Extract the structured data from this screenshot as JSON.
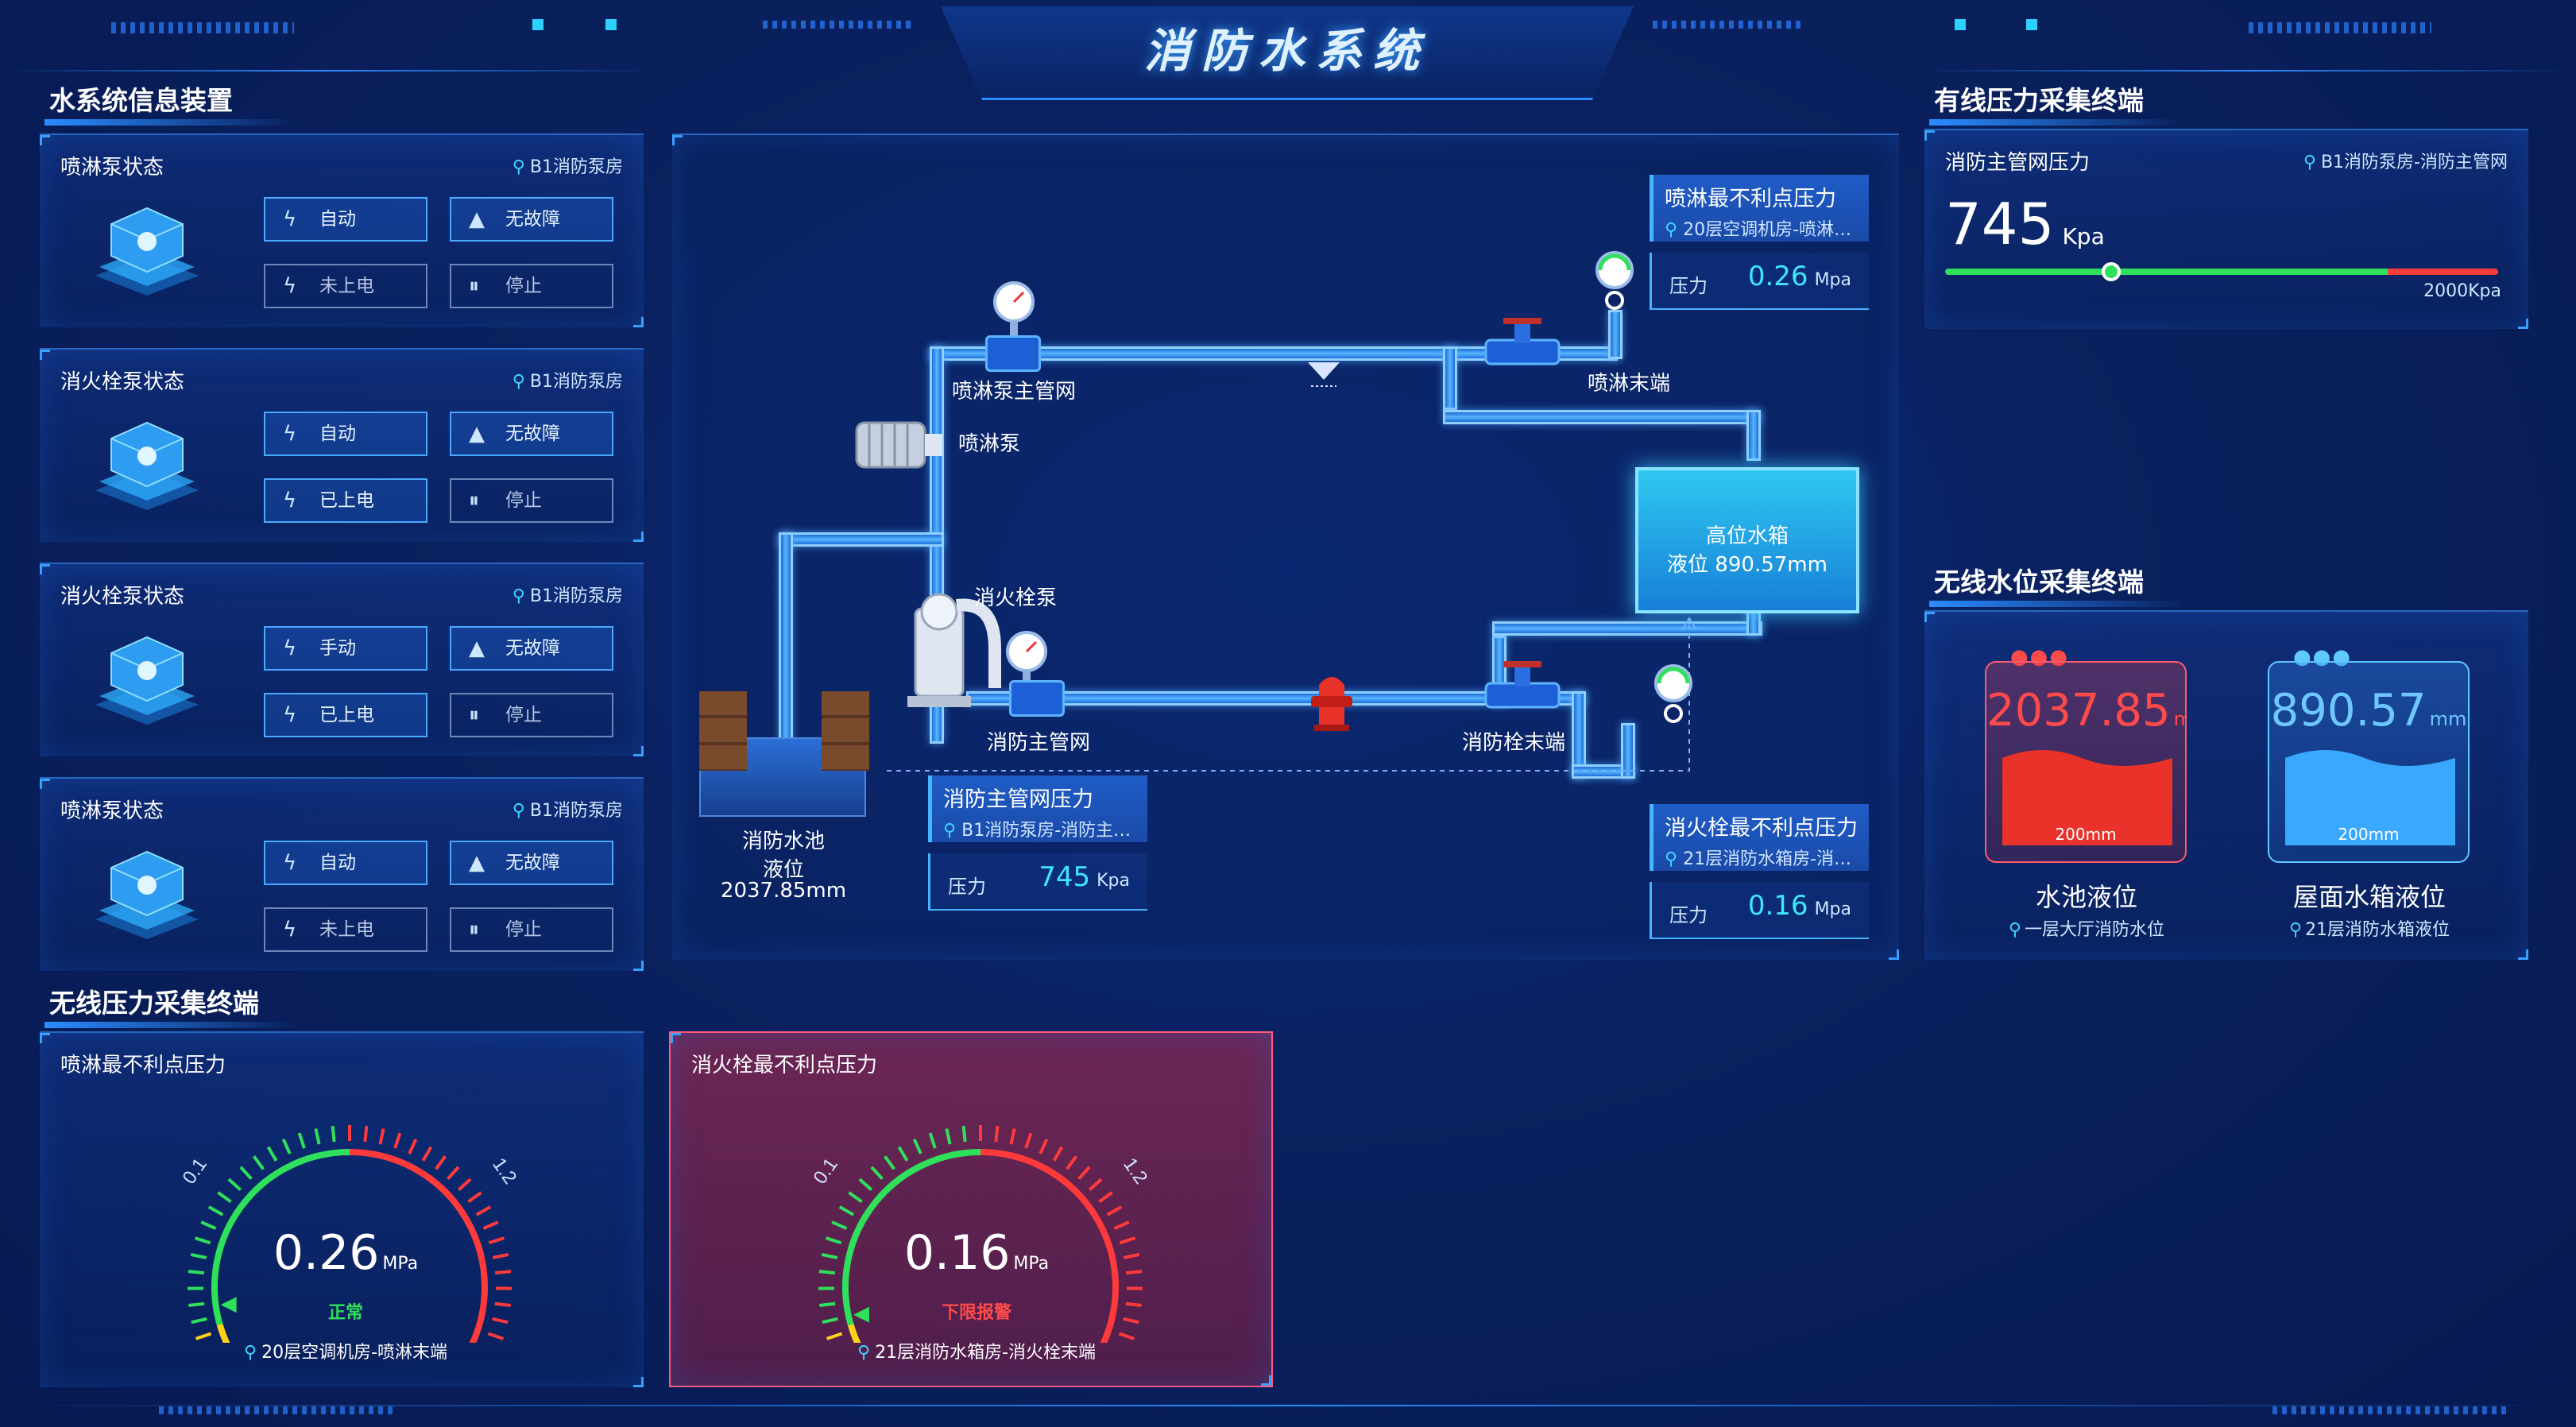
{
  "header": {
    "title": "消防水系统"
  },
  "left": {
    "section_title": "水系统信息装置",
    "pumps": [
      {
        "title": "喷淋泵状态",
        "location": "B1消防泵房",
        "mode": "自动",
        "fault": "无故障",
        "power": "未上电",
        "run": "停止",
        "icon": "sprinkler-pump-icon"
      },
      {
        "title": "消火栓泵状态",
        "location": "B1消防泵房",
        "mode": "自动",
        "fault": "无故障",
        "power": "已上电",
        "run": "停止",
        "icon": "hydrant-pump-icon"
      },
      {
        "title": "消火栓泵状态",
        "location": "B1消防泵房",
        "mode": "手动",
        "fault": "无故障",
        "power": "已上电",
        "run": "停止",
        "icon": "hydrant-pump-icon"
      },
      {
        "title": "喷淋泵状态",
        "location": "B1消防泵房",
        "mode": "自动",
        "fault": "无故障",
        "power": "未上电",
        "run": "停止",
        "icon": "sprinkler-pump-icon"
      }
    ]
  },
  "wireless_pressure": {
    "section_title": "无线压力采集终端",
    "gauges": [
      {
        "title": "喷淋最不利点压力",
        "value": "0.26",
        "value_num": 0.26,
        "unit": "MPa",
        "status": "正常",
        "status_color": "#2fe05a",
        "min_label": "0.1",
        "max_label": "1.2",
        "location": "20层空调机房-喷淋末端",
        "alarm": false
      },
      {
        "title": "消火栓最不利点压力",
        "value": "0.16",
        "value_num": 0.16,
        "unit": "MPa",
        "status": "下限报警",
        "status_color": "#ff4a4a",
        "min_label": "0.1",
        "max_label": "1.2",
        "location": "21层消防水箱房-消火栓末端",
        "alarm": true
      }
    ]
  },
  "diagram": {
    "labels": {
      "sprinkler_main": "喷淋泵主管网",
      "sprinkler_pump": "喷淋泵",
      "sprinkler_end": "喷淋末端",
      "hydrant_pump": "消火栓泵",
      "fire_main": "消防主管网",
      "hydrant_end": "消防栓末端",
      "tank_title": "高位水箱",
      "tank_level": "液位 890.57mm",
      "pool_name": "消防水池",
      "pool_level_label": "液位",
      "pool_level": "2037.85mm"
    },
    "cards": {
      "sprinkler_worst": {
        "title": "喷淋最不利点压力",
        "location": "20层空调机房-喷淋…",
        "key": "压力",
        "value": "0.26",
        "unit": "Mpa"
      },
      "main_pressure": {
        "title": "消防主管网压力",
        "location": "B1消防泵房-消防主…",
        "key": "压力",
        "value": "745",
        "unit": "Kpa"
      },
      "hydrant_worst": {
        "title": "消火栓最不利点压力",
        "location": "21层消防水箱房-消火…",
        "key": "压力",
        "value": "0.16",
        "unit": "Mpa"
      }
    }
  },
  "wired_pressure": {
    "section_title": "有线压力采集终端",
    "title": "消防主管网压力",
    "location": "B1消防泵房-消防主管网",
    "value": "745",
    "unit": "Kpa",
    "max_label": "2000Kpa",
    "fraction": 0.3
  },
  "wireless_level": {
    "section_title": "无线水位采集终端",
    "tanks": [
      {
        "value": "2037.85",
        "unit": "mm",
        "scale": "200mm",
        "name": "水池液位",
        "location": "一层大厅消防水位",
        "color": "#ff4a4a"
      },
      {
        "value": "890.57",
        "unit": "mm",
        "scale": "200mm",
        "name": "屋面水箱液位",
        "location": "21层消防水箱液位",
        "color": "#5ec8ff"
      }
    ]
  }
}
